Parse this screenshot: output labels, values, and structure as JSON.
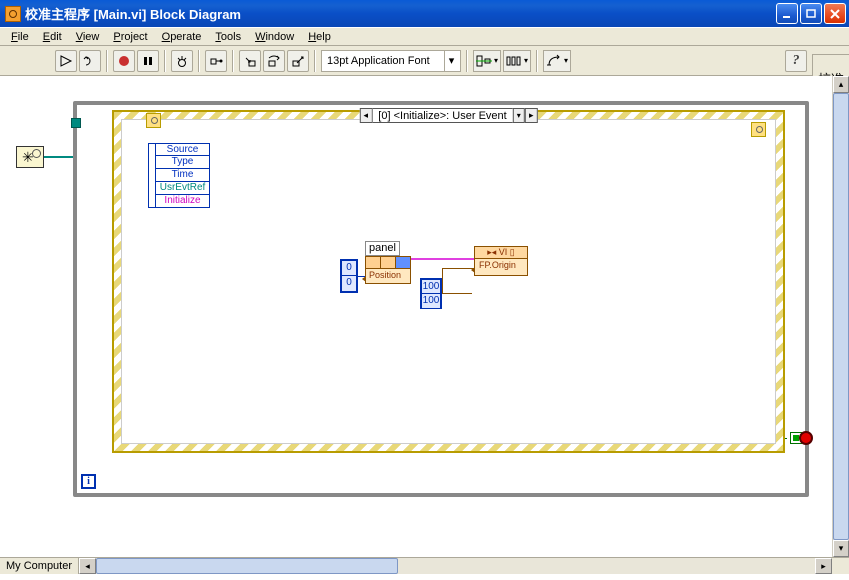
{
  "window": {
    "title": "校准主程序  [Main.vi] Block Diagram"
  },
  "menu": {
    "file": "File",
    "edit": "Edit",
    "view": "View",
    "project": "Project",
    "operate": "Operate",
    "tools": "Tools",
    "window": "Window",
    "help": "Help"
  },
  "toolbar": {
    "font": "13pt Application Font"
  },
  "corner_label": "校准",
  "event": {
    "selector": "[0] <Initialize>: User Event",
    "fields": [
      "Source",
      "Type",
      "Time",
      "UsrEvtRef",
      "Initialize"
    ]
  },
  "consts": {
    "zero": "0",
    "hundred": "100"
  },
  "nodes": {
    "panel_label": "panel",
    "position_prop": "Position",
    "vi_header": "▸◂ VI ▯",
    "fporigin_prop": "FP.Origin"
  },
  "loop": {
    "i": "i"
  },
  "status": {
    "context": "My Computer"
  }
}
